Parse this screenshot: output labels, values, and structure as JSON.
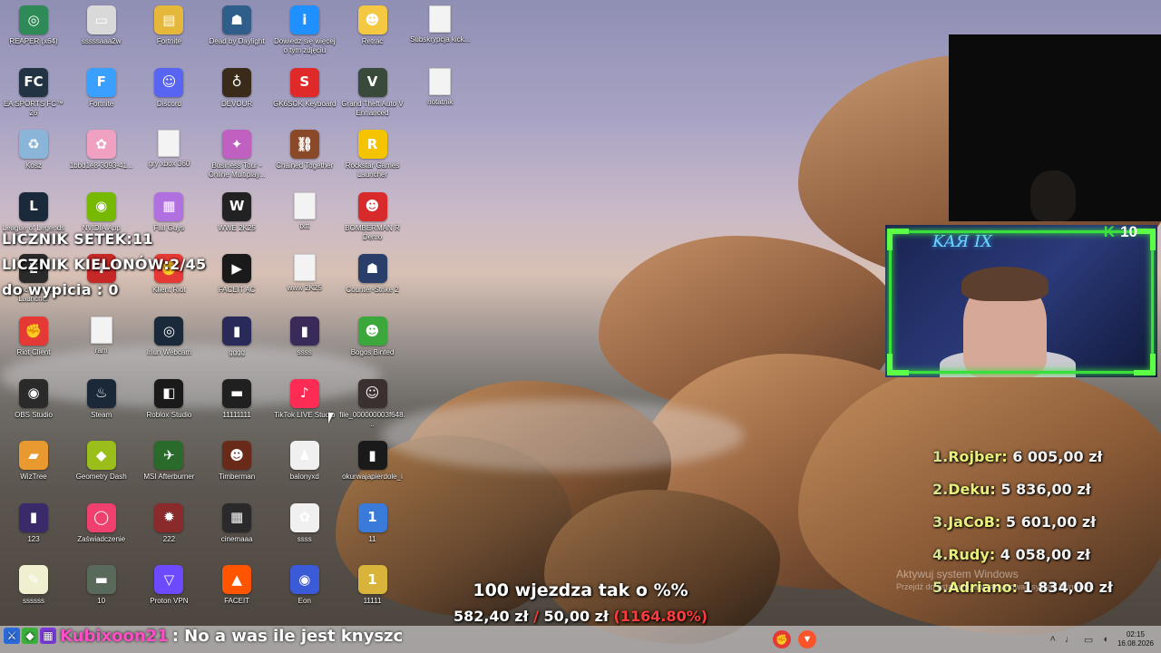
{
  "desktop_icons": [
    {
      "label": "REAPER (x64)",
      "color": "#2e8b57",
      "glyph": "◎",
      "col": 0,
      "row": 0
    },
    {
      "label": "sssssaaa2w",
      "color": "#d9d9d9",
      "glyph": "▭",
      "col": 1,
      "row": 0
    },
    {
      "label": "Fortnite",
      "color": "#e5b73a",
      "glyph": "▤",
      "col": 2,
      "row": 0
    },
    {
      "label": "Dead by Daylight",
      "color": "#2f5e8a",
      "glyph": "☗",
      "col": 3,
      "row": 0
    },
    {
      "label": "Dowiedz się więcej o tym zdjęciu",
      "color": "#1e90ff",
      "glyph": "i",
      "col": 4,
      "row": 0
    },
    {
      "label": "Retrac",
      "color": "#f5c842",
      "glyph": "☻",
      "col": 5,
      "row": 0
    },
    {
      "label": "Subskrypcja kick...",
      "color": "",
      "glyph": "",
      "col": 6,
      "row": 0,
      "file": true
    },
    {
      "label": "EA SPORTS FC™ 26",
      "color": "#223344",
      "glyph": "FC",
      "col": 0,
      "row": 1
    },
    {
      "label": "Fortnite",
      "color": "#3aa0ff",
      "glyph": "F",
      "col": 1,
      "row": 1
    },
    {
      "label": "Discord",
      "color": "#5865f2",
      "glyph": "☺",
      "col": 2,
      "row": 1
    },
    {
      "label": "DEVOUR",
      "color": "#3a2a1a",
      "glyph": "♁",
      "col": 3,
      "row": 1
    },
    {
      "label": "GK6SOK Keyboard",
      "color": "#e02a2a",
      "glyph": "S",
      "col": 4,
      "row": 1
    },
    {
      "label": "Grand Theft Auto V Enhanced",
      "color": "#3a4a3a",
      "glyph": "V",
      "col": 5,
      "row": 1
    },
    {
      "label": "notatnik",
      "color": "",
      "glyph": "",
      "col": 6,
      "row": 1,
      "file": true
    },
    {
      "label": "Kosz",
      "color": "#8ab4d8",
      "glyph": "♻",
      "col": 0,
      "row": 2
    },
    {
      "label": "1bbd1e8-3093-41...",
      "color": "#f0a0c0",
      "glyph": "✿",
      "col": 1,
      "row": 2
    },
    {
      "label": "gry xbox 360",
      "color": "",
      "glyph": "",
      "col": 2,
      "row": 2,
      "file": true
    },
    {
      "label": "Business Tour - Online Multiplay...",
      "color": "#c060c0",
      "glyph": "✦",
      "col": 3,
      "row": 2
    },
    {
      "label": "Chained Together",
      "color": "#8a4a2a",
      "glyph": "⛓",
      "col": 4,
      "row": 2
    },
    {
      "label": "Rockstar Games Launcher",
      "color": "#f4c400",
      "glyph": "R",
      "col": 5,
      "row": 2
    },
    {
      "label": "League of Legends",
      "color": "#1a2a3a",
      "glyph": "L",
      "col": 0,
      "row": 3
    },
    {
      "label": "NVIDIA App",
      "color": "#76b900",
      "glyph": "◉",
      "col": 1,
      "row": 3
    },
    {
      "label": "Fall Guys",
      "color": "#b070e0",
      "glyph": "▦",
      "col": 2,
      "row": 3
    },
    {
      "label": "WWE 2K25",
      "color": "#222222",
      "glyph": "W",
      "col": 3,
      "row": 3
    },
    {
      "label": "txtt",
      "color": "",
      "glyph": "",
      "col": 4,
      "row": 3,
      "file": true
    },
    {
      "label": "BOMBERMAN R Demo",
      "color": "#d82a2a",
      "glyph": "☻",
      "col": 5,
      "row": 3
    },
    {
      "label": "Epic Games Launcher",
      "color": "#2a2a2a",
      "glyph": "E",
      "col": 0,
      "row": 4
    },
    {
      "label": "",
      "color": "#c62828",
      "glyph": "✚",
      "col": 1,
      "row": 4
    },
    {
      "label": "Klient Riot",
      "color": "#e53935",
      "glyph": "✊",
      "col": 2,
      "row": 4
    },
    {
      "label": "FACEIT AC",
      "color": "#1a1a1a",
      "glyph": "▶",
      "col": 3,
      "row": 4
    },
    {
      "label": "www 2K25",
      "color": "",
      "glyph": "",
      "col": 4,
      "row": 4,
      "file": true
    },
    {
      "label": "Counter-Strike 2",
      "color": "#2a3e6a",
      "glyph": "☗",
      "col": 5,
      "row": 4
    },
    {
      "label": "Riot Client",
      "color": "#e53935",
      "glyph": "✊",
      "col": 0,
      "row": 5
    },
    {
      "label": "ram",
      "color": "",
      "glyph": "",
      "col": 1,
      "row": 5,
      "file": true
    },
    {
      "label": "Iriun Webcam",
      "color": "#1a2a3a",
      "glyph": "◎",
      "col": 2,
      "row": 5
    },
    {
      "label": "gggg",
      "color": "#2a2a5a",
      "glyph": "▮",
      "col": 3,
      "row": 5
    },
    {
      "label": "ssss",
      "color": "#3a2a5a",
      "glyph": "▮",
      "col": 4,
      "row": 5
    },
    {
      "label": "Bogos Binted",
      "color": "#3ca83c",
      "glyph": "☻",
      "col": 5,
      "row": 5
    },
    {
      "label": "OBS Studio",
      "color": "#2a2a2a",
      "glyph": "◉",
      "col": 0,
      "row": 6
    },
    {
      "label": "Steam",
      "color": "#1b2838",
      "glyph": "♨",
      "col": 1,
      "row": 6
    },
    {
      "label": "Roblox Studio",
      "color": "#1a1a1a",
      "glyph": "◧",
      "col": 2,
      "row": 6
    },
    {
      "label": "11111111",
      "color": "#202020",
      "glyph": "▬",
      "col": 3,
      "row": 6
    },
    {
      "label": "TikTok LIVE Studio",
      "color": "#fe2c55",
      "glyph": "♪",
      "col": 4,
      "row": 6
    },
    {
      "label": "file_000000003f648...",
      "color": "#3a3030",
      "glyph": "☺",
      "col": 5,
      "row": 6
    },
    {
      "label": "WizTree",
      "color": "#e89a30",
      "glyph": "▰",
      "col": 0,
      "row": 7
    },
    {
      "label": "Geometry Dash",
      "color": "#9bbf1a",
      "glyph": "◆",
      "col": 1,
      "row": 7
    },
    {
      "label": "MSI Afterburner",
      "color": "#2a6a2a",
      "glyph": "✈",
      "col": 2,
      "row": 7
    },
    {
      "label": "Timberman",
      "color": "#6a2a1a",
      "glyph": "☻",
      "col": 3,
      "row": 7
    },
    {
      "label": "balonyxd",
      "color": "#f0f0f0",
      "glyph": "♟",
      "col": 4,
      "row": 7
    },
    {
      "label": "okurwajapierdole_i",
      "color": "#1a1a1a",
      "glyph": "▮",
      "col": 5,
      "row": 7
    },
    {
      "label": "123",
      "color": "#3a2a6a",
      "glyph": "▮",
      "col": 0,
      "row": 8
    },
    {
      "label": "Zaświadczenie",
      "color": "#f04070",
      "glyph": "◯",
      "col": 1,
      "row": 8
    },
    {
      "label": "222",
      "color": "#8a2a2a",
      "glyph": "✹",
      "col": 2,
      "row": 8
    },
    {
      "label": "cinemaaa",
      "color": "#2a2a2a",
      "glyph": "▦",
      "col": 3,
      "row": 8
    },
    {
      "label": "ssss",
      "color": "#f0f0f0",
      "glyph": "✿",
      "col": 4,
      "row": 8
    },
    {
      "label": "11",
      "color": "#3a7ad8",
      "glyph": "1",
      "col": 5,
      "row": 8
    },
    {
      "label": "ssssss",
      "color": "#f0f0d0",
      "glyph": "✎",
      "col": 0,
      "row": 9
    },
    {
      "label": "10",
      "color": "#5a6a5a",
      "glyph": "▬",
      "col": 1,
      "row": 9
    },
    {
      "label": "Proton VPN",
      "color": "#6d4aff",
      "glyph": "▽",
      "col": 2,
      "row": 9
    },
    {
      "label": "FACEIT",
      "color": "#ff5500",
      "glyph": "▲",
      "col": 3,
      "row": 9
    },
    {
      "label": "Eon",
      "color": "#3a5ad8",
      "glyph": "◉",
      "col": 4,
      "row": 9
    },
    {
      "label": "11111",
      "color": "#d8b43a",
      "glyph": "1",
      "col": 5,
      "row": 9
    }
  ],
  "counter": {
    "line1": "LICZNIK SETEK:11",
    "line2": "LICZNIK KIELONÓW:2/45",
    "line3": "do wypicia : 0"
  },
  "webcam": {
    "neon_sign": "KAЯ IX",
    "badge_value": "10"
  },
  "leaderboard": [
    {
      "rank": "1.",
      "name": "Rojber:",
      "amount": "6 005,00 zł"
    },
    {
      "rank": "2.",
      "name": "Deku:",
      "amount": "5 836,00 zł"
    },
    {
      "rank": "3.",
      "name": "JaCoB:",
      "amount": "5 601,00 zł"
    },
    {
      "rank": "4.",
      "name": "Rudy:",
      "amount": "4 058,00 zł"
    },
    {
      "rank": "5.",
      "name": "Adriano:",
      "amount": "1 834,00 zł"
    }
  ],
  "windows_activation": {
    "title": "Aktywuj system Windows",
    "subtitle": "Przejdź do ustawień, aby aktywować system Windows."
  },
  "donation_goal": {
    "title": "100 wjezdza tak o %%",
    "current": "582,40 zł",
    "separator": "/",
    "target": "50,00 zł",
    "percent": "(1164.80%)"
  },
  "chat": {
    "user": "Kubixoon21",
    "message": ": No a was ile jest knyszc"
  },
  "taskbar": {
    "time": "02:15",
    "date": "16.08.2026"
  },
  "colors": {
    "neon_green": "#39e03c",
    "leader_name": "#e9f07a",
    "goal_red": "#ff3b3b",
    "chat_user": "#ff4fc7"
  }
}
